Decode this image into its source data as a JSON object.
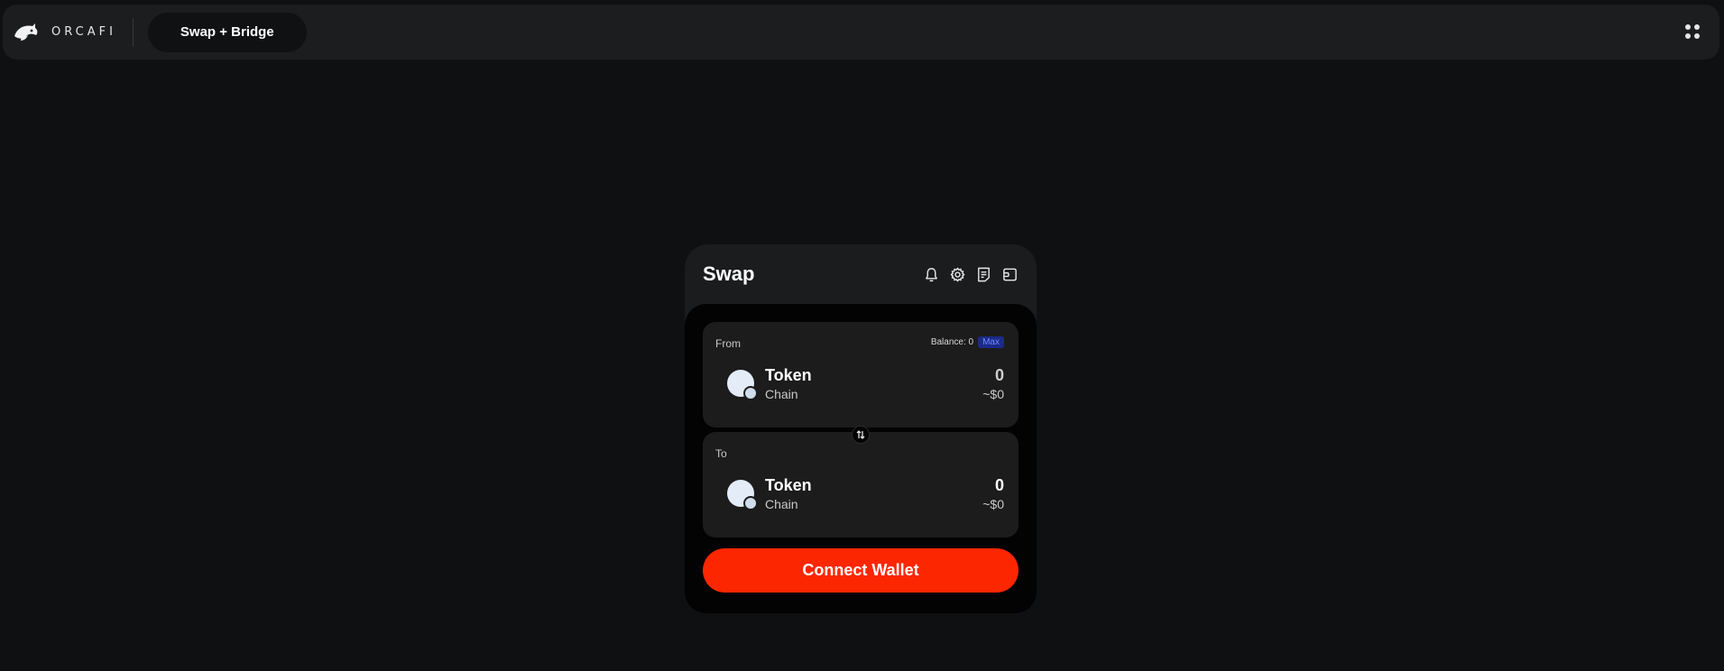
{
  "header": {
    "brand": "ORCAFI",
    "nav_label": "Swap + Bridge",
    "menu_icon": "grid-dots-icon"
  },
  "swap": {
    "title": "Swap",
    "icons": [
      "bell-icon",
      "settings-gear-icon",
      "history-receipt-icon",
      "wallet-icon"
    ],
    "from": {
      "label": "From",
      "balance_label": "Balance: 0",
      "max_label": "Max",
      "token": "Token",
      "chain": "Chain",
      "amount": "0",
      "usd": "~$0"
    },
    "to": {
      "label": "To",
      "token": "Token",
      "chain": "Chain",
      "amount": "0",
      "usd": "~$0"
    },
    "connect_label": "Connect Wallet"
  },
  "colors": {
    "accent": "#fc2600",
    "max_badge_bg": "#1b2a8a",
    "max_badge_text": "#6f8bff",
    "page_bg": "#0f1012"
  }
}
